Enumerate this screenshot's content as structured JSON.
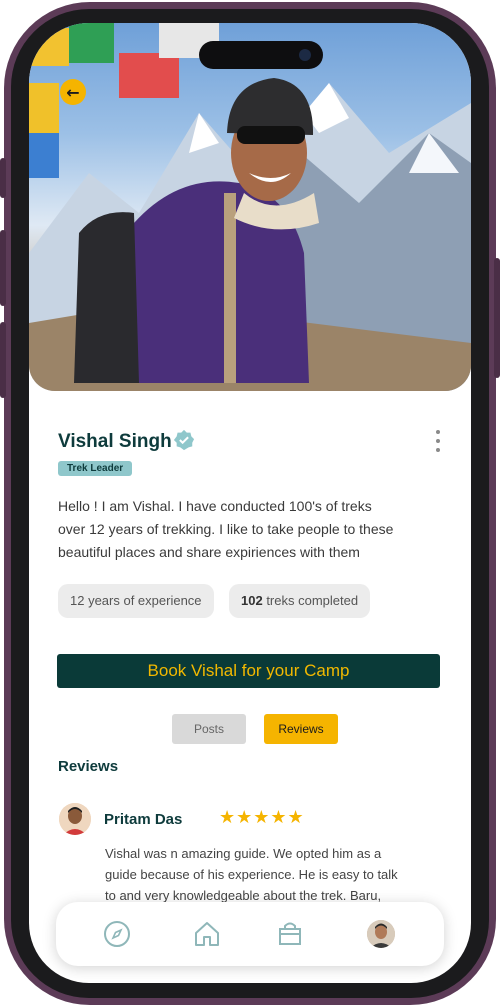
{
  "profile": {
    "name": "Vishal Singh",
    "role": "Trek Leader",
    "bio": "Hello ! I am Vishal.  I have conducted 100's of treks over 12 years of trekking. I like to take people to these beautiful places and share expiriences with them",
    "stats": {
      "experience": "12 years of experience",
      "treks_count": "102",
      "treks_label": " treks completed"
    }
  },
  "actions": {
    "book_label": "Book Vishal for your Camp"
  },
  "tabs": [
    {
      "label": "Posts",
      "active": false
    },
    {
      "label": "Reviews",
      "active": true
    }
  ],
  "reviews_section": {
    "title": "Reviews",
    "items": [
      {
        "reviewer": "Pritam Das",
        "rating": 5,
        "stars": "★★★★★",
        "text": "Vishal was n amazing guide. We opted him as a guide because of his experience. He is easy to talk to and very knowledgeable about the trek. Baru, provided an amazing experience to me and my family. He helped a lot."
      }
    ]
  },
  "nav": {
    "items": [
      "compass-icon",
      "home-icon",
      "bag-icon",
      "profile-avatar"
    ]
  },
  "colors": {
    "accent": "#f5b400",
    "primary_dark": "#0a3a38",
    "badge": "#8fc7cb",
    "frame": "#5c3b57"
  }
}
